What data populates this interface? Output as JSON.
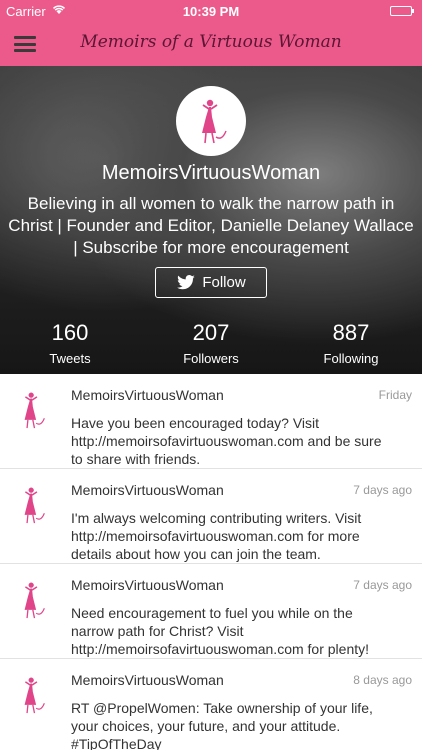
{
  "status_bar": {
    "carrier": "Carrier",
    "time": "10:39 PM",
    "wifi_icon": "wifi-icon",
    "battery_level": 1.0
  },
  "nav": {
    "title": "Memoirs of a Virtuous Woman",
    "menu_icon": "hamburger-menu-icon"
  },
  "colors": {
    "brand_pink": "#ec5a8c",
    "title_text": "#5b1632",
    "logo_pink": "#e0458a"
  },
  "profile": {
    "name": "MemoirsVirtuousWoman",
    "bio": "Believing in all women to walk the narrow path in Christ | Founder and Editor, Danielle Delaney Wallace | Subscribe for more encouragement",
    "follow_label": "Follow",
    "stats": [
      {
        "value": "160",
        "label": "Tweets"
      },
      {
        "value": "207",
        "label": "Followers"
      },
      {
        "value": "887",
        "label": "Following"
      }
    ]
  },
  "tweets": [
    {
      "user": "MemoirsVirtuousWoman",
      "time": "Friday",
      "text": "Have you been encouraged today? Visit http://memoirsofavirtuouswoman.com and be sure to share with friends."
    },
    {
      "user": "MemoirsVirtuousWoman",
      "time": "7 days ago",
      "text": "I'm always welcoming contributing writers. Visit http://memoirsofavirtuouswoman.com for more details about how you can join the team."
    },
    {
      "user": "MemoirsVirtuousWoman",
      "time": "7 days ago",
      "text": "Need encouragement to fuel you while on the narrow path for Christ? Visit http://memoirsofavirtuouswoman.com for plenty!"
    },
    {
      "user": "MemoirsVirtuousWoman",
      "time": "8 days ago",
      "text": "RT @PropelWomen: Take ownership of your life, your choices, your future, and your attitude. #TipOfTheDay"
    }
  ]
}
